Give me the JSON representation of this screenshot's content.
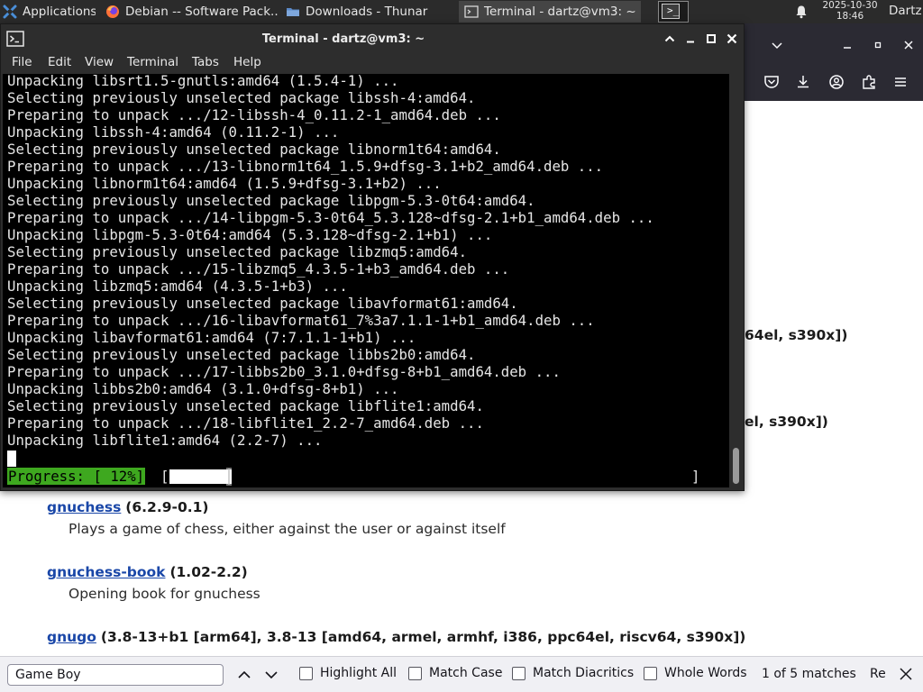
{
  "panel": {
    "applications_label": "Applications",
    "tasks": [
      {
        "label": "Debian -- Software Pack...",
        "icon": "firefox-icon"
      },
      {
        "label": "Downloads - Thunar",
        "icon": "folder-icon"
      },
      {
        "label": "Terminal - dartz@vm3: ~",
        "icon": "terminal-icon"
      }
    ],
    "workspace_glyph": ">_",
    "clock_date": "2025-10-30",
    "clock_time": "18:46",
    "user": "Dartz"
  },
  "terminal": {
    "title": "Terminal - dartz@vm3: ~",
    "menu": [
      "File",
      "Edit",
      "View",
      "Terminal",
      "Tabs",
      "Help"
    ],
    "lines": [
      "Unpacking libsrt1.5-gnutls:amd64 (1.5.4-1) ...",
      "Selecting previously unselected package libssh-4:amd64.",
      "Preparing to unpack .../12-libssh-4_0.11.2-1_amd64.deb ...",
      "Unpacking libssh-4:amd64 (0.11.2-1) ...",
      "Selecting previously unselected package libnorm1t64:amd64.",
      "Preparing to unpack .../13-libnorm1t64_1.5.9+dfsg-3.1+b2_amd64.deb ...",
      "Unpacking libnorm1t64:amd64 (1.5.9+dfsg-3.1+b2) ...",
      "Selecting previously unselected package libpgm-5.3-0t64:amd64.",
      "Preparing to unpack .../14-libpgm-5.3-0t64_5.3.128~dfsg-2.1+b1_amd64.deb ...",
      "Unpacking libpgm-5.3-0t64:amd64 (5.3.128~dfsg-2.1+b1) ...",
      "Selecting previously unselected package libzmq5:amd64.",
      "Preparing to unpack .../15-libzmq5_4.3.5-1+b3_amd64.deb ...",
      "Unpacking libzmq5:amd64 (4.3.5-1+b3) ...",
      "Selecting previously unselected package libavformat61:amd64.",
      "Preparing to unpack .../16-libavformat61_7%3a7.1.1-1+b1_amd64.deb ...",
      "Unpacking libavformat61:amd64 (7:7.1.1-1+b1) ...",
      "Selecting previously unselected package libbs2b0:amd64.",
      "Preparing to unpack .../17-libbs2b0_3.1.0+dfsg-8+b1_amd64.deb ...",
      "Unpacking libbs2b0:amd64 (3.1.0+dfsg-8+b1) ...",
      "Selecting previously unselected package libflite1:amd64.",
      "Preparing to unpack .../18-libflite1_2.2-7_amd64.deb ...",
      "Unpacking libflite1:amd64 (2.2-7) ..."
    ],
    "progress_label": "Progress: [ 12%]",
    "progress_bracket_left": "[",
    "progress_bracket_right": "]",
    "progress_fraction": 0.12
  },
  "browser": {
    "fragments": [
      "64el, s390x])",
      "el, s390x])"
    ],
    "packages": [
      {
        "name": "gnuchess",
        "version": "(6.2.9-0.1)",
        "description": "Plays a game of chess, either against the user or against itself"
      },
      {
        "name": "gnuchess-book",
        "version": "(1.02-2.2)",
        "description": "Opening book for gnuchess"
      },
      {
        "name": "gnugo",
        "version": "(3.8-13+b1 [arm64], 3.8-13 [amd64, armel, armhf, i386, ppc64el, riscv64, s390x])",
        "description": ""
      }
    ]
  },
  "findbar": {
    "query": "Game Boy",
    "highlight_all": "Highlight All",
    "match_case": "Match Case",
    "match_diacritics": "Match Diacritics",
    "whole_words": "Whole Words",
    "match_count": "1 of 5 matches",
    "cut_label": "Re"
  },
  "colors": {
    "panel": "#2b2b2b",
    "terminal_bg": "#000000",
    "progress_green": "#3ea81f",
    "link_blue": "#1a47a8"
  }
}
